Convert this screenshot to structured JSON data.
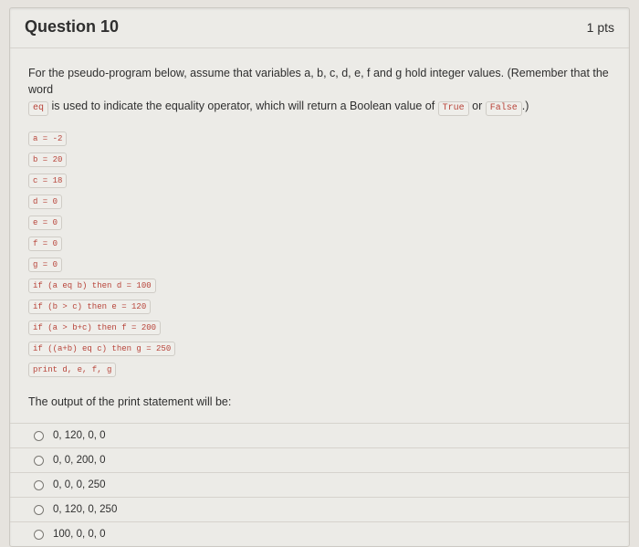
{
  "header": {
    "title": "Question 10",
    "points": "1 pts"
  },
  "intro": {
    "line1_pre": "For the pseudo-program below, assume that variables a, b, c, d, e, f and g hold integer values. (Remember that the word",
    "pill_eq": "eq",
    "line2_a": " is used to indicate the equality operator, which will return a Boolean value of ",
    "pill_true": "True",
    "line2_b": " or ",
    "pill_false": "False",
    "line2_c": ".)"
  },
  "code": [
    "a = -2",
    "b = 20",
    "c = 18",
    "d = 0",
    "e = 0",
    "f = 0",
    "g = 0",
    "if (a eq b) then d = 100",
    "if (b > c) then e = 120",
    "if (a > b+c) then f = 200",
    "if ((a+b) eq c) then g = 250",
    "print d, e, f, g"
  ],
  "prompt2": "The output of the print statement will be:",
  "options": [
    "0, 120, 0, 0",
    "0, 0, 200, 0",
    "0, 0, 0, 250",
    "0, 120, 0, 250",
    "100, 0, 0, 0"
  ]
}
